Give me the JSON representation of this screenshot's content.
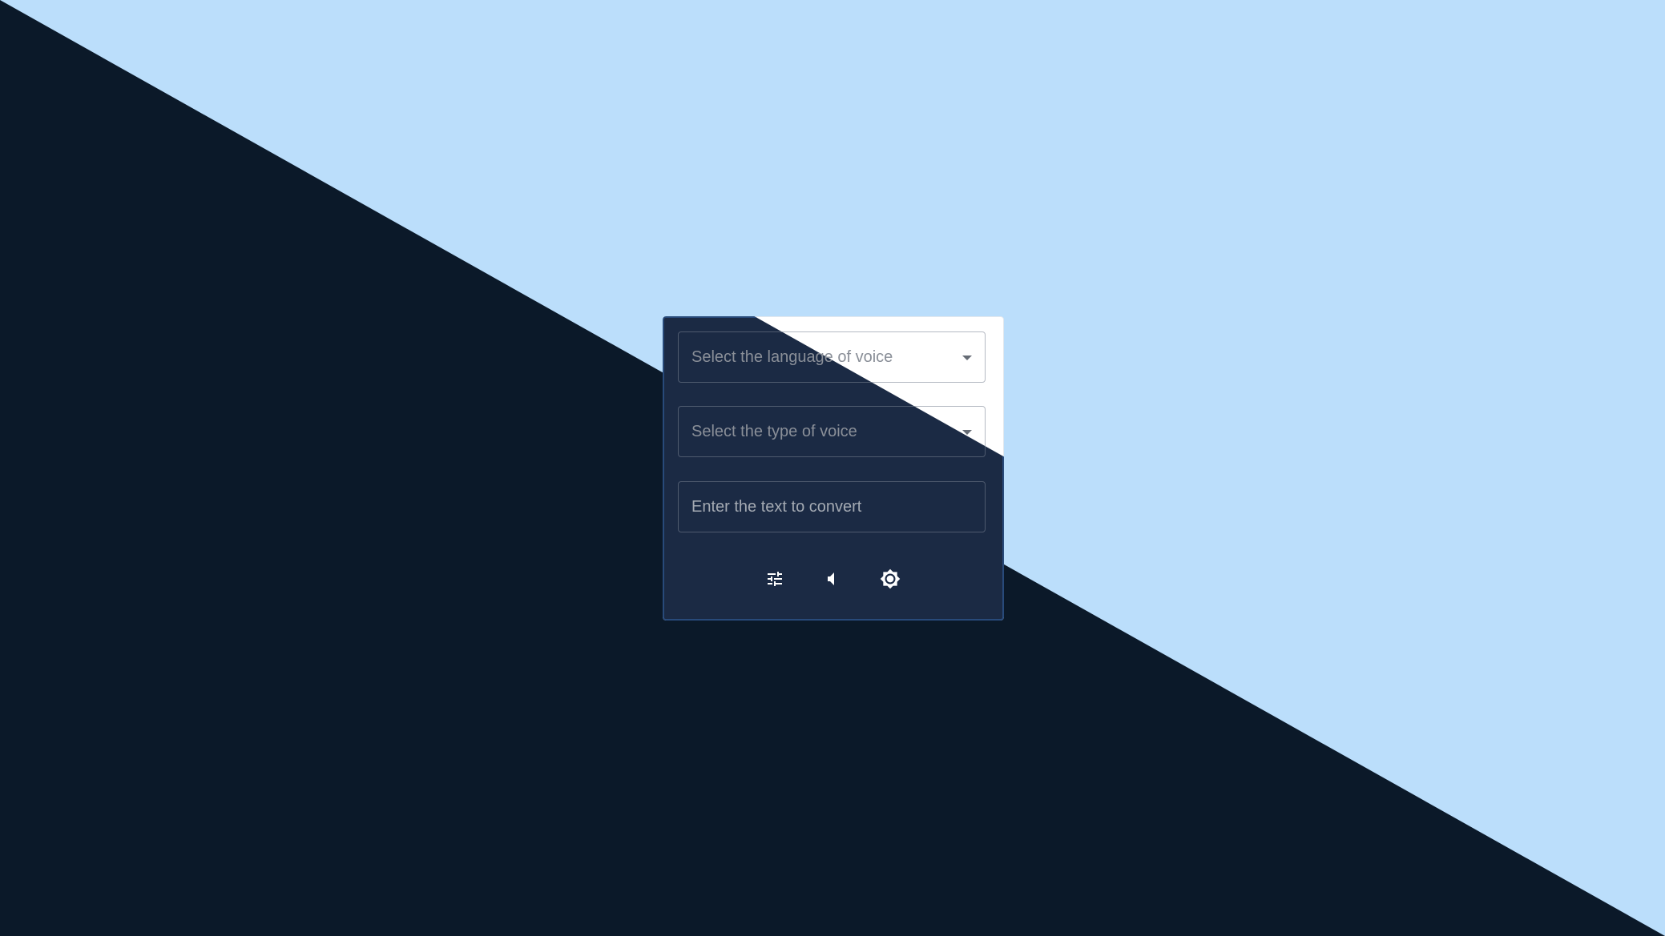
{
  "form": {
    "language_select": {
      "placeholder": "Select the language of voice"
    },
    "voice_select": {
      "placeholder": "Select the type of voice"
    },
    "text_input": {
      "placeholder": "Enter the text to convert"
    }
  },
  "toolbar": {
    "buttons": [
      {
        "icon": "tune-icon"
      },
      {
        "icon": "volume-icon"
      },
      {
        "icon": "brightness-icon"
      }
    ]
  },
  "colors": {
    "background_light": "#bbdefb",
    "background_dark": "#0b1929",
    "card_light": "#ffffff",
    "card_dark": "#1b2a44",
    "icon": "#ffffff"
  }
}
